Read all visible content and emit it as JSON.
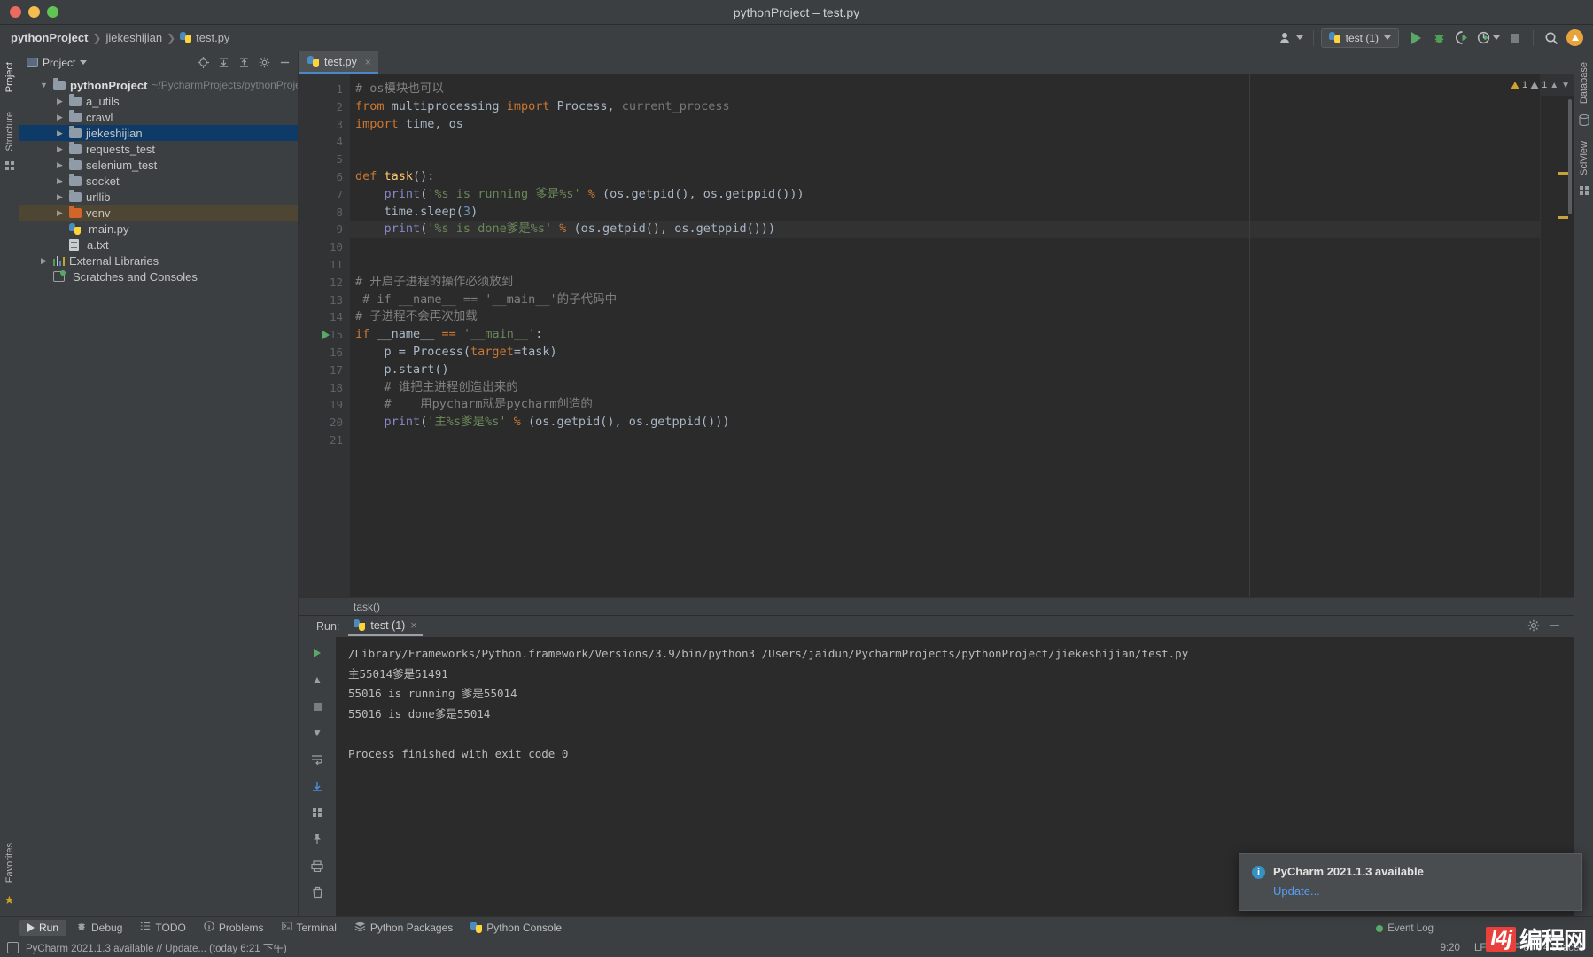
{
  "window": {
    "title": "pythonProject – test.py"
  },
  "breadcrumbs": [
    {
      "label": "pythonProject",
      "icon": ""
    },
    {
      "label": "jiekeshijian",
      "icon": ""
    },
    {
      "label": "test.py",
      "icon": "python-file-icon"
    }
  ],
  "toolbar": {
    "run_config_label": "test (1)",
    "icons": [
      "user-settings-icon",
      "run-icon",
      "debug-icon",
      "run-coverage-icon",
      "profile-icon",
      "stop-icon",
      "search-icon",
      "update-icon"
    ]
  },
  "left_strip": {
    "tabs": [
      "Project",
      "Structure"
    ],
    "bottom_tabs": [
      "Favorites"
    ]
  },
  "right_strip": {
    "tabs": [
      "Database",
      "SciView"
    ]
  },
  "project_panel": {
    "title": "Project",
    "actions": [
      "locate-icon",
      "expand-all-icon",
      "collapse-all-icon",
      "settings-icon",
      "hide-icon"
    ],
    "tree": [
      {
        "label": "pythonProject",
        "path": "~/PycharmProjects/pythonProject",
        "icon": "folder-icon",
        "arrow": "down",
        "depth": 0,
        "bold": true,
        "state": "normal"
      },
      {
        "label": "a_utils",
        "icon": "folder-icon",
        "arrow": "right",
        "depth": 1,
        "state": "normal"
      },
      {
        "label": "crawl",
        "icon": "folder-icon",
        "arrow": "right",
        "depth": 1,
        "state": "normal"
      },
      {
        "label": "jiekeshijian",
        "icon": "folder-icon",
        "arrow": "right",
        "depth": 1,
        "state": "selected"
      },
      {
        "label": "requests_test",
        "icon": "folder-icon",
        "arrow": "right",
        "depth": 1,
        "state": "normal"
      },
      {
        "label": "selenium_test",
        "icon": "folder-icon",
        "arrow": "right",
        "depth": 1,
        "state": "normal"
      },
      {
        "label": "socket",
        "icon": "folder-icon",
        "arrow": "right",
        "depth": 1,
        "state": "normal"
      },
      {
        "label": "urllib",
        "icon": "folder-icon",
        "arrow": "right",
        "depth": 1,
        "state": "normal"
      },
      {
        "label": "venv",
        "icon": "folder-orange-icon",
        "arrow": "right",
        "depth": 1,
        "state": "highlight"
      },
      {
        "label": "main.py",
        "icon": "python-file-icon",
        "arrow": "none",
        "depth": 2,
        "state": "normal"
      },
      {
        "label": "a.txt",
        "icon": "text-file-icon",
        "arrow": "none",
        "depth": 2,
        "state": "normal"
      },
      {
        "label": "External Libraries",
        "icon": "library-icon",
        "arrow": "right",
        "depth": 0,
        "state": "normal"
      },
      {
        "label": "Scratches and Consoles",
        "icon": "scratches-icon",
        "arrow": "none",
        "depth": 0,
        "state": "normal"
      }
    ]
  },
  "editor": {
    "tab_label": "test.py",
    "tab_close": "×",
    "breadcrumb_bottom": "task()",
    "warnings": {
      "warn_count": "1",
      "weak_count": "1"
    },
    "lines": [
      {
        "n": 1,
        "marks": []
      },
      {
        "n": 2,
        "marks": [
          "fold"
        ]
      },
      {
        "n": 3,
        "marks": [
          "fold"
        ]
      },
      {
        "n": 4,
        "marks": []
      },
      {
        "n": 5,
        "marks": []
      },
      {
        "n": 6,
        "marks": [
          "fold"
        ]
      },
      {
        "n": 7,
        "marks": []
      },
      {
        "n": 8,
        "marks": []
      },
      {
        "n": 9,
        "marks": [
          "fold",
          "bulb"
        ]
      },
      {
        "n": 10,
        "marks": []
      },
      {
        "n": 11,
        "marks": []
      },
      {
        "n": 12,
        "marks": [
          "fold"
        ]
      },
      {
        "n": 13,
        "marks": []
      },
      {
        "n": 14,
        "marks": [
          "fold"
        ]
      },
      {
        "n": 15,
        "marks": [
          "fold",
          "run"
        ]
      },
      {
        "n": 16,
        "marks": []
      },
      {
        "n": 17,
        "marks": []
      },
      {
        "n": 18,
        "marks": [
          "fold"
        ]
      },
      {
        "n": 19,
        "marks": [
          "fold"
        ]
      },
      {
        "n": 20,
        "marks": [
          "fold"
        ]
      },
      {
        "n": 21,
        "marks": []
      }
    ],
    "source": [
      "# os模块也可以",
      "from multiprocessing import Process, current_process",
      "import time, os",
      "",
      "",
      "def task():",
      "    print('%s is running 爹是%s' % (os.getpid(), os.getppid()))",
      "    time.sleep(3)",
      "    print('%s is done爹是%s' % (os.getpid(), os.getppid()))",
      "",
      "",
      "# 开启子进程的操作必须放到",
      "# if __name__ == '__main__'的子代码中",
      "# 子进程不会再次加载",
      "if __name__ == '__main__':",
      "    p = Process(target=task)",
      "    p.start()",
      "    # 谁把主进程创造出来的",
      "    #    用pycharm就是pycharm创造的",
      "    print('主%s爹是%s' % (os.getpid(), os.getppid()))",
      ""
    ]
  },
  "run_panel": {
    "label": "Run:",
    "tab_label": "test (1)",
    "tab_close": "×",
    "side_icons": [
      "rerun-icon",
      "scroll-up-icon",
      "stop-icon",
      "scroll-down-icon",
      "soft-wrap-icon",
      "print-icon",
      "trash-icon",
      "pin-icon"
    ],
    "header_icons": [
      "settings-icon",
      "hide-icon"
    ],
    "console": [
      "/Library/Frameworks/Python.framework/Versions/3.9/bin/python3 /Users/jaidun/PycharmProjects/pythonProject/jiekeshijian/test.py",
      "主55014爹是51491",
      "55016 is running 爹是55014",
      "55016 is done爹是55014",
      "",
      "Process finished with exit code 0"
    ]
  },
  "bottom_tabs": [
    {
      "label": "Run",
      "icon": "run-icon",
      "active": true
    },
    {
      "label": "Debug",
      "icon": "debug-icon",
      "active": false
    },
    {
      "label": "TODO",
      "icon": "todo-icon",
      "active": false
    },
    {
      "label": "Problems",
      "icon": "problems-icon",
      "active": false
    },
    {
      "label": "Terminal",
      "icon": "terminal-icon",
      "active": false
    },
    {
      "label": "Python Packages",
      "icon": "packages-icon",
      "active": false
    },
    {
      "label": "Python Console",
      "icon": "python-console-icon",
      "active": false
    }
  ],
  "status_bar": {
    "message": "PyCharm 2021.1.3 available // Update... (today 6:21 下午)",
    "caret": "9:20",
    "line_sep": "LF",
    "encoding": "UTF-8",
    "indent": "4 spaces",
    "event_log": "Event Log"
  },
  "notification": {
    "title": "PyCharm 2021.1.3 available",
    "link": "Update...",
    "icon": "info-icon"
  },
  "watermark": {
    "mark": "l4j",
    "text": "编程网"
  },
  "colors": {
    "accent_blue": "#4a88c7",
    "selection_blue": "#0d3a67",
    "highlight_brown": "#4e4632",
    "keyword_orange": "#cc7832",
    "string_green": "#6a8759",
    "comment_gray": "#808080",
    "number_blue": "#6897bb",
    "function_yellow": "#ffc66d",
    "builtin_purple": "#8888c6",
    "panel_bg": "#3c3f41",
    "editor_bg": "#2b2b2b",
    "link_blue": "#589df6"
  }
}
